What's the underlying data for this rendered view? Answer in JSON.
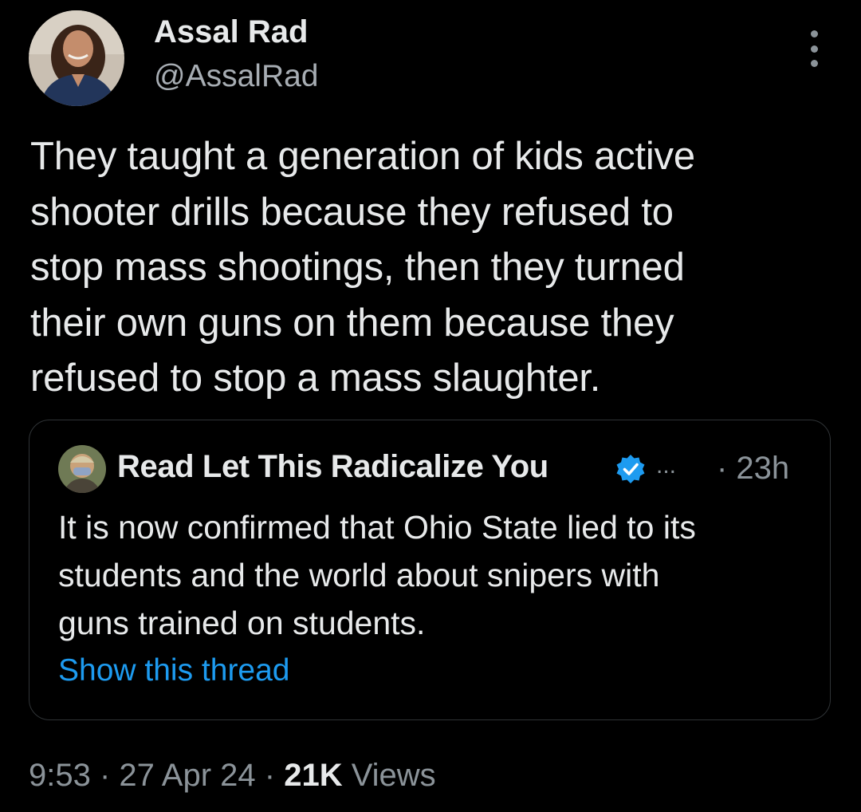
{
  "author": {
    "name": "Assal Rad",
    "handle": "@AssalRad"
  },
  "tweet": {
    "text": "They taught a generation of kids active\nshooter drills because they refused to\nstop mass shootings, then they turned\ntheir own guns on them because they\nrefused to stop a mass slaughter."
  },
  "quoted": {
    "name": "Read Let This Radicalize You",
    "ellipsis": "...",
    "time": "· 23h",
    "text": "It is now confirmed that Ohio State lied to its\nstudents and the world about snipers with\nguns trained on students.",
    "show_thread": "Show this thread"
  },
  "meta": {
    "time": "9:53",
    "sep1": " · ",
    "date": "27 Apr 24",
    "sep2": " · ",
    "views_count": "21K",
    "views_label": " Views"
  },
  "icons": {
    "more": "more-vertical-icon",
    "verified": "verified-badge-icon"
  },
  "colors": {
    "background": "#000000",
    "text_primary": "#e7e9ea",
    "text_secondary": "#8b9399",
    "link": "#1d9bf0",
    "border": "#2f3336"
  }
}
